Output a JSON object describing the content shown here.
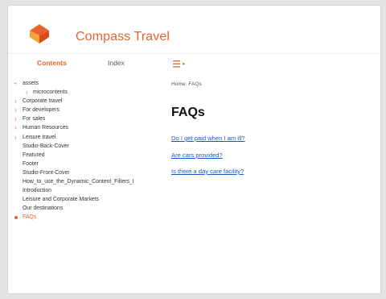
{
  "brand": {
    "name": "Compass Travel",
    "logo_icon": "compass-logo-icon",
    "accent": "#e8632b"
  },
  "tabs": [
    {
      "label": "Contents",
      "active": true
    },
    {
      "label": "Index",
      "active": false
    }
  ],
  "menu_toggle_icon": "hamburger-menu-icon",
  "sidebar": {
    "items": [
      {
        "label": "assets",
        "marker": "chevron-down",
        "indent": false
      },
      {
        "label": "microcontents",
        "marker": "chevron-right",
        "indent": true
      },
      {
        "label": "Corporate travel",
        "marker": "chevron-right",
        "indent": false
      },
      {
        "label": "For developers",
        "marker": "chevron-right",
        "indent": false
      },
      {
        "label": "For sales",
        "marker": "chevron-right",
        "indent": false
      },
      {
        "label": "Human Resources",
        "marker": "chevron-right",
        "indent": false
      },
      {
        "label": "Leisure travel",
        "marker": "chevron-right",
        "indent": false
      },
      {
        "label": "Studio-Back-Cover",
        "marker": "none",
        "indent": false
      },
      {
        "label": "Featured",
        "marker": "none",
        "indent": false
      },
      {
        "label": "Footer",
        "marker": "none",
        "indent": false
      },
      {
        "label": "Studio-Front-Cover",
        "marker": "none",
        "indent": false
      },
      {
        "label": "How_to_use_the_Dynamic_Content_Filters_I",
        "marker": "none",
        "indent": false
      },
      {
        "label": "Introduction",
        "marker": "none",
        "indent": false
      },
      {
        "label": "Leisure and Corporate Markets",
        "marker": "none",
        "indent": false
      },
      {
        "label": "Our destinations",
        "marker": "none",
        "indent": false
      },
      {
        "label": "FAQs",
        "marker": "bullet",
        "indent": false,
        "active": true
      }
    ]
  },
  "content": {
    "breadcrumb": "Home: FAQs",
    "title": "FAQs",
    "links": [
      "Do I get paid when I am ill?",
      "Are cars provided?",
      "Is there a day care facility?"
    ]
  }
}
